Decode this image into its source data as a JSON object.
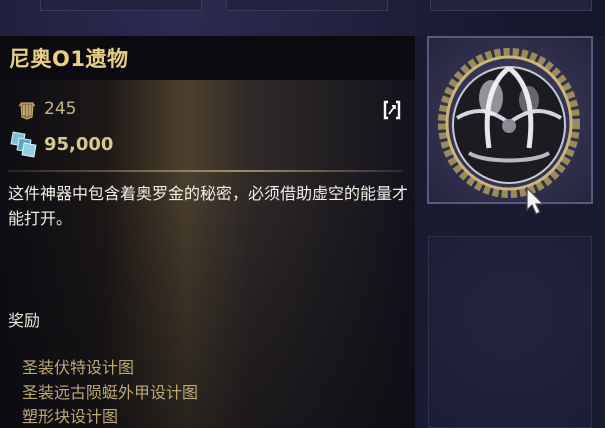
{
  "item": {
    "name": "尼奥O1遗物",
    "ticket_value": "245",
    "cost_value": "95,000",
    "description": "这件神器中包含着奥罗金的秘密，必须借助虚空的能量才能打开。"
  },
  "rewards": {
    "label": "奖励",
    "items": [
      "圣装伏特设计图",
      "圣装远古陨蜓外甲设计图",
      "塑形块设计图"
    ]
  },
  "icons": {
    "ticket": "ducat-ticket-icon",
    "currency": "crystal-credits-icon",
    "expand": "expand-toggle-icon",
    "relic": "void-relic-image",
    "cursor": "mouse-cursor-icon"
  },
  "colors": {
    "title": "#e8cf84",
    "reward_text": "#bfa778",
    "panel_dark": "#0a0a10"
  }
}
